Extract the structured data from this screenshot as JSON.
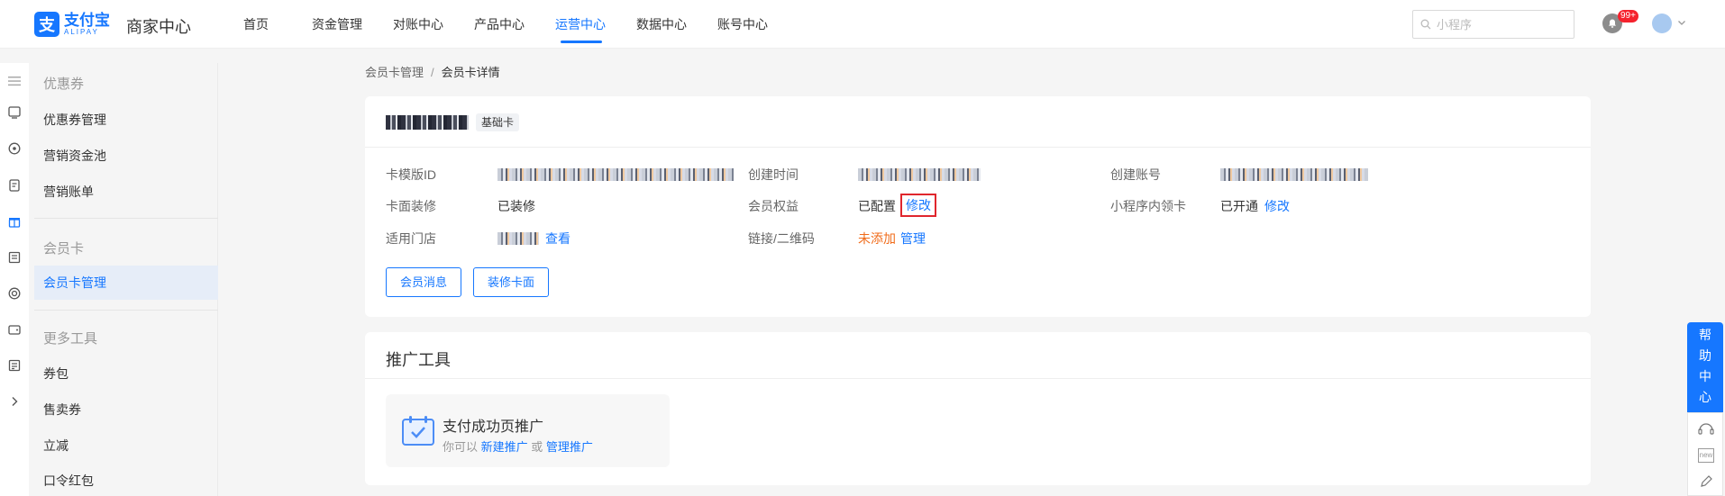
{
  "header": {
    "logo_cn": "支付宝",
    "logo_en": "ALIPAY",
    "app_name": "商家中心",
    "nav": [
      {
        "label": "首页"
      },
      {
        "label": "资金管理"
      },
      {
        "label": "对账中心"
      },
      {
        "label": "产品中心"
      },
      {
        "label": "运营中心",
        "active": true
      },
      {
        "label": "数据中心"
      },
      {
        "label": "账号中心"
      }
    ],
    "search_placeholder": "小程序",
    "notify_badge": "99+"
  },
  "sidebar": {
    "groups": [
      {
        "title": "优惠券",
        "items": [
          "优惠券管理",
          "营销资金池",
          "营销账单"
        ]
      },
      {
        "title": "会员卡",
        "items": [
          "会员卡管理"
        ]
      },
      {
        "title": "更多工具",
        "items": [
          "券包",
          "售卖券",
          "立减",
          "口令红包"
        ]
      }
    ],
    "active_item": "会员卡管理"
  },
  "breadcrumb": {
    "parent": "会员卡管理",
    "separator": "/",
    "current": "会员卡详情"
  },
  "card_detail": {
    "tag": "基础卡",
    "fields": {
      "template_id_label": "卡模版ID",
      "created_time_label": "创建时间",
      "created_account_label": "创建账号",
      "card_face_label": "卡面装修",
      "card_face_value": "已装修",
      "benefits_label": "会员权益",
      "benefits_value": "已配置",
      "benefits_action": "修改",
      "mini_program_label": "小程序内领卡",
      "mini_program_value": "已开通",
      "mini_program_action": "修改",
      "stores_label": "适用门店",
      "stores_action": "查看",
      "qrcode_label": "链接/二维码",
      "qrcode_value": "未添加",
      "qrcode_action": "管理"
    },
    "buttons": {
      "member_message": "会员消息",
      "decorate_card": "装修卡面"
    }
  },
  "promotion": {
    "title": "推广工具",
    "item_title": "支付成功页推广",
    "item_desc_prefix": "你可以",
    "item_link_new": "新建推广",
    "item_desc_or": "或",
    "item_link_manage": "管理推广"
  },
  "help_float": {
    "label_chars": [
      "帮",
      "助",
      "中",
      "心"
    ],
    "tool_new": "new"
  },
  "colors": {
    "accent": "#1677ff",
    "warning": "#f06b1a",
    "highlight": "#e0262d"
  }
}
